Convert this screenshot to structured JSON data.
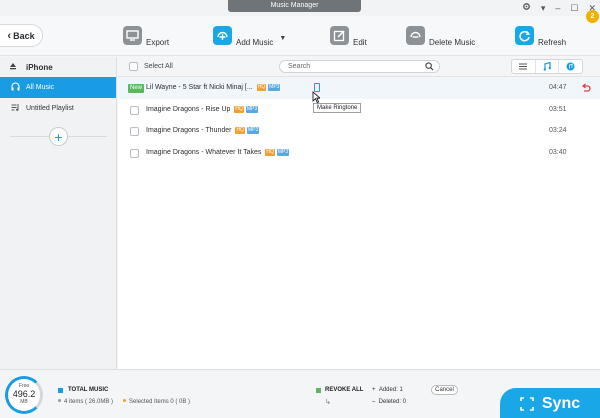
{
  "window": {
    "title": "Music Manager",
    "controls": [
      "gear-icon",
      "minimize-icon",
      "maximize-icon",
      "close-icon"
    ]
  },
  "toolbar": {
    "back_label": "Back",
    "export_label": "Export",
    "add_music_label": "Add Music",
    "edit_label": "Edit",
    "delete_label": "Delete Music",
    "refresh_label": "Refresh"
  },
  "sidebar": {
    "device": "iPhone",
    "items": [
      {
        "label": "All Music",
        "icon": "headphones-icon",
        "active": true
      },
      {
        "label": "Untitled Playlist",
        "icon": "playlist-icon",
        "active": false
      }
    ]
  },
  "list_header": {
    "select_all": "Select All",
    "search_placeholder": "Search"
  },
  "songs": [
    {
      "badge": "New",
      "title": "Lil Wayne - 5 Star ft Nicki Minaj [...",
      "tags": [
        "HQ",
        "MP3"
      ],
      "duration": "04:47"
    },
    {
      "title": "Imagine Dragons - Rise Up",
      "tags": [
        "HQ",
        "MP3"
      ],
      "duration": "03:51"
    },
    {
      "title": "Imagine Dragons - Thunder",
      "tags": [
        "HQ",
        "MP3"
      ],
      "duration": "03:24"
    },
    {
      "title": "Imagine Dragons - Whatever It Takes",
      "tags": [
        "HQ",
        "MP3"
      ],
      "duration": "03:40"
    }
  ],
  "tooltip": "Make Ringtone",
  "footer": {
    "free_label": "Free",
    "free_value": "496.2",
    "free_unit": "MB",
    "total_music": "TOTAL MUSIC",
    "items_text": "4 items ( 26.0MB )",
    "selected_text": "Selected Items 0 ( 0B )",
    "revoke_all": "REVOKE ALL",
    "added": "Added: 1",
    "deleted": "Deleted: 0",
    "cancel": "Cancel",
    "sync": "Sync",
    "sync_badge": "2"
  },
  "colors": {
    "accent": "#1a9ce5",
    "new_badge": "#5cb85c",
    "hq_tag": "#f0a030",
    "mp3_tag": "#59a8e0",
    "revoke": "#e04040"
  }
}
